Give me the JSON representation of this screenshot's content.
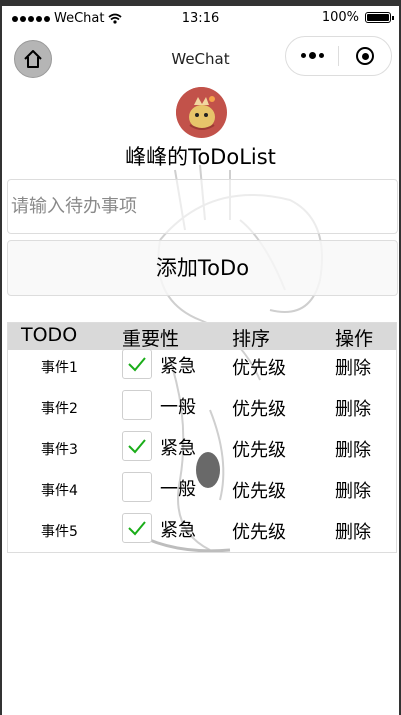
{
  "status_bar": {
    "carrier": "WeChat",
    "time": "13:16",
    "battery": "100%"
  },
  "nav": {
    "title": "WeChat"
  },
  "app": {
    "title": "峰峰的ToDoList",
    "input_placeholder": "请输入待办事项",
    "add_button": "添加ToDo"
  },
  "table": {
    "headers": [
      "TODO",
      "重要性",
      "排序",
      "操作"
    ],
    "rows": [
      {
        "name": "事件1",
        "checked": true,
        "level": "紧急",
        "priority": "优先级",
        "action": "删除"
      },
      {
        "name": "事件2",
        "checked": false,
        "level": "一般",
        "priority": "优先级",
        "action": "删除"
      },
      {
        "name": "事件3",
        "checked": true,
        "level": "紧急",
        "priority": "优先级",
        "action": "删除"
      },
      {
        "name": "事件4",
        "checked": false,
        "level": "一般",
        "priority": "优先级",
        "action": "删除"
      },
      {
        "name": "事件5",
        "checked": true,
        "level": "紧急",
        "priority": "优先级",
        "action": "删除"
      }
    ]
  },
  "colors": {
    "check": "#1aad19",
    "header_bg": "#d9d9d9",
    "avatar_bg": "#c2524a"
  }
}
